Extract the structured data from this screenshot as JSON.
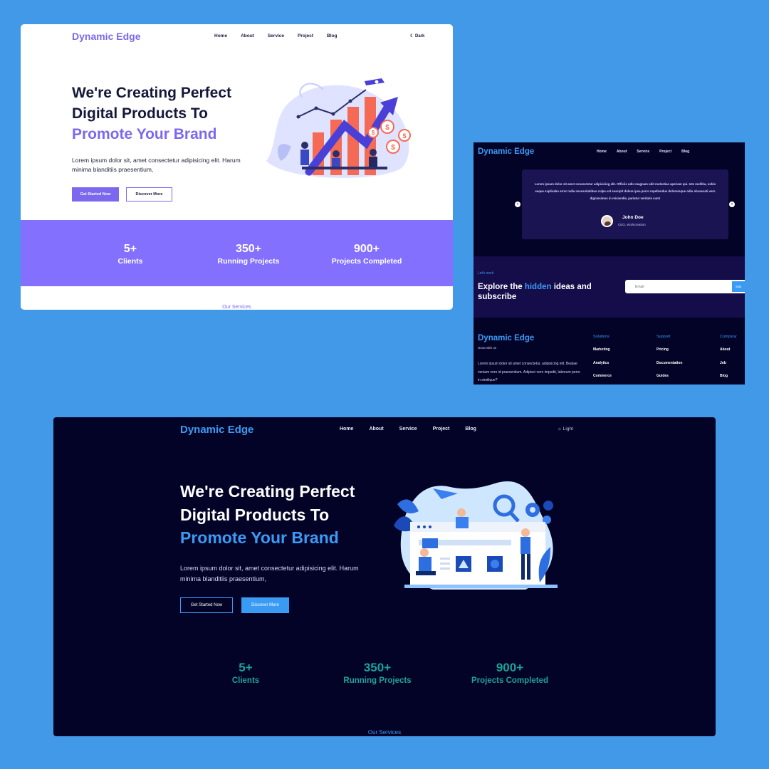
{
  "light_screen": {
    "logo": "Dynamic Edge",
    "nav": [
      "Home",
      "About",
      "Service",
      "Project",
      "Blog"
    ],
    "mode_toggle": "Dark",
    "hero": {
      "title_line1": "We're Creating Perfect",
      "title_line2": "Digital Products To",
      "title_accent": "Promote Your Brand",
      "description": "Lorem ipsum dolor sit, amet consectetur adipisicing elit. Harum minima blanditiis praesentium,",
      "primary_button": "Get Started Now",
      "secondary_button": "Discover More"
    },
    "stats": [
      {
        "value": "5+",
        "label": "Clients"
      },
      {
        "value": "350+",
        "label": "Running Projects"
      },
      {
        "value": "900+",
        "label": "Projects Completed"
      }
    ],
    "services_label": "Our Services"
  },
  "mid_screen": {
    "logo": "Dynamic Edge",
    "nav": [
      "Home",
      "About",
      "Service",
      "Project",
      "Blog"
    ],
    "testimonial": {
      "quote": "Lorem ipsum dolor sit amet consectetur adipisicing elit. Officiis odio magnam odit molestiae aperiam qui. Iste mollitia, nobis eaque explicabo error nulla necessitatibus culpa vel suscipit dolore ipsa porro repellendus doloremque odio obcaecati vero dignissimos in reiciendis, pariatur veritatis cum!",
      "name": "John Doe",
      "role": "CEO, Workcreation"
    },
    "subscribe": {
      "kicker": "Let's work",
      "head_before": "Explore the ",
      "head_highlight": "hidden",
      "head_after": " ideas and subscribe",
      "email_placeholder": "Email",
      "button": "Sub"
    },
    "footer": {
      "logo": "Dynamic Edge",
      "tagline": "Grow with us",
      "description": "Lorem ipsum dolor sit amet consectetur, adipisicing elit. Beatae veniam vero id praesentium. Adipisci vero impedit, laborum porro in similique?",
      "columns": [
        {
          "title": "Solutions",
          "items": [
            "Marketing",
            "Analytics",
            "Commerce"
          ]
        },
        {
          "title": "Support",
          "items": [
            "Pricing",
            "Documentation",
            "Guides"
          ]
        },
        {
          "title": "Company",
          "items": [
            "About",
            "Job",
            "Blog"
          ]
        }
      ]
    }
  },
  "dark_screen": {
    "logo": "Dynamic Edge",
    "nav": [
      "Home",
      "About",
      "Service",
      "Project",
      "Blog"
    ],
    "mode_toggle": "Light",
    "hero": {
      "title_line1": "We're Creating Perfect",
      "title_line2": "Digital Products To",
      "title_accent": "Promote Your Brand",
      "description": "Lorem ipsum dolor sit, amet consectetur adipisicing elit. Harum minima blanditiis praesentium,",
      "primary_button": "Get Started Now",
      "secondary_button": "Discover More"
    },
    "stats": [
      {
        "value": "5+",
        "label": "Clients"
      },
      {
        "value": "350+",
        "label": "Running Projects"
      },
      {
        "value": "900+",
        "label": "Projects Completed"
      }
    ],
    "services_label": "Our Services"
  },
  "colors": {
    "background": "#4299e8",
    "light_accent": "#7b68ee",
    "dark_accent": "#3a9bf5",
    "dark_bg": "#020326",
    "stat_teal": "#1aa39b"
  }
}
